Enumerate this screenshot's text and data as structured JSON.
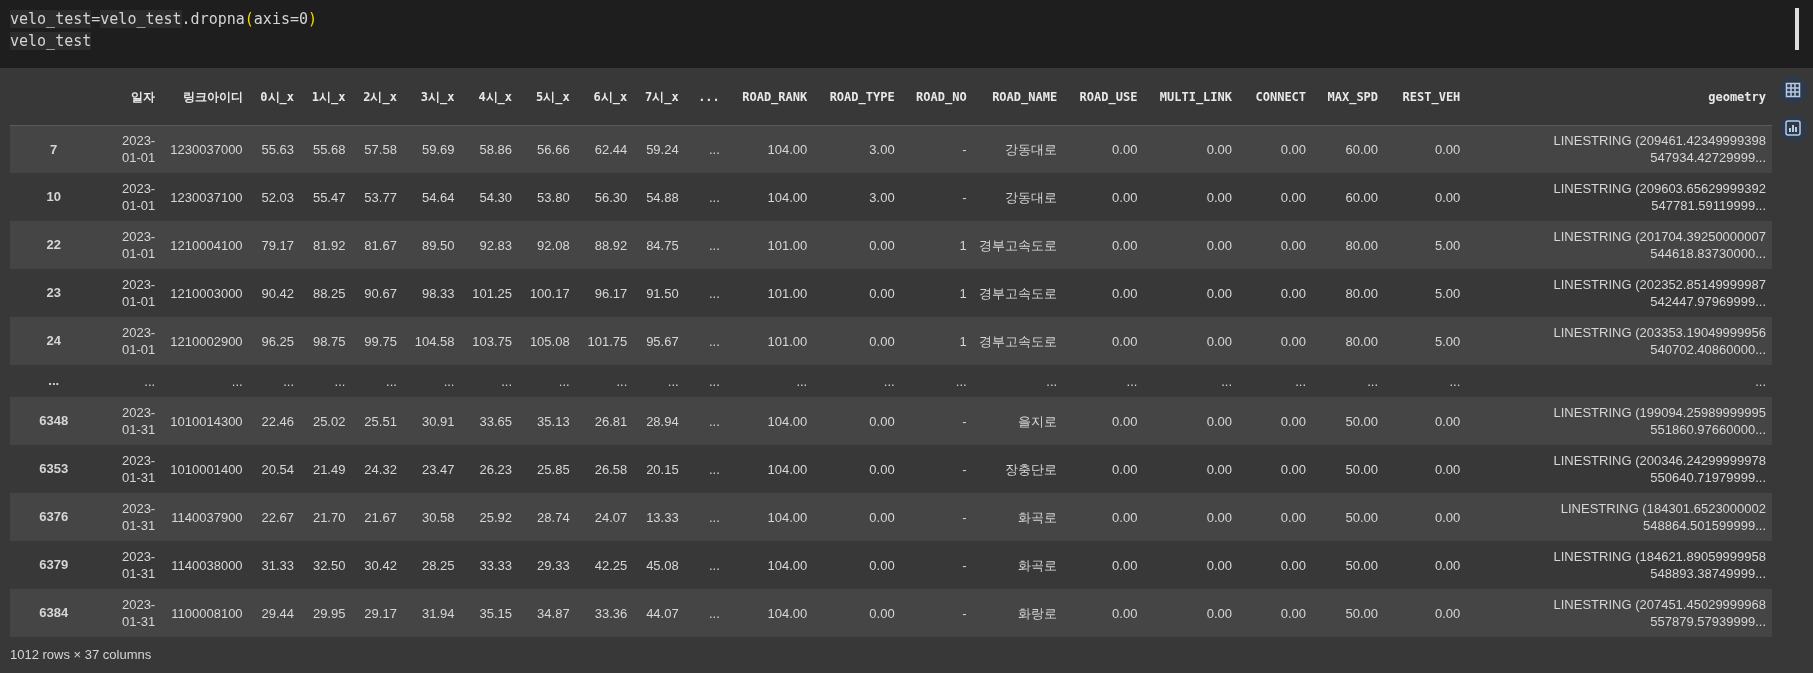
{
  "code_cell": {
    "lines": [
      [
        {
          "text": "velo_test",
          "kind": "match"
        },
        {
          "text": "=",
          "kind": "plain"
        },
        {
          "text": "velo_test",
          "kind": "match"
        },
        {
          "text": ".dropna",
          "kind": "plain"
        },
        {
          "text": "(",
          "kind": "paren"
        },
        {
          "text": "axis=0",
          "kind": "plain"
        },
        {
          "text": ")",
          "kind": "paren"
        }
      ],
      [
        {
          "text": "velo_test",
          "kind": "match"
        }
      ]
    ]
  },
  "table": {
    "columns": [
      "",
      "일자",
      "링크아이디",
      "0시_x",
      "1시_x",
      "2시_x",
      "3시_x",
      "4시_x",
      "5시_x",
      "6시_x",
      "7시_x",
      "...",
      "ROAD_RANK",
      "ROAD_TYPE",
      "ROAD_NO",
      "ROAD_NAME",
      "ROAD_USE",
      "MULTI_LINK",
      "CONNECT",
      "MAX_SPD",
      "REST_VEH",
      "geometry"
    ],
    "rows": [
      {
        "kind": "data",
        "cells": [
          "7",
          "2023-01-01",
          "1230037000",
          "55.63",
          "55.68",
          "57.58",
          "59.69",
          "58.86",
          "56.66",
          "62.44",
          "59.24",
          "...",
          "104.00",
          "3.00",
          "-",
          "강동대로",
          "0.00",
          "0.00",
          "0.00",
          "60.00",
          "0.00",
          "LINESTRING (209461.42349999398 547934.42729999..."
        ]
      },
      {
        "kind": "data",
        "cells": [
          "10",
          "2023-01-01",
          "1230037100",
          "52.03",
          "55.47",
          "53.77",
          "54.64",
          "54.30",
          "53.80",
          "56.30",
          "54.88",
          "...",
          "104.00",
          "3.00",
          "-",
          "강동대로",
          "0.00",
          "0.00",
          "0.00",
          "60.00",
          "0.00",
          "LINESTRING (209603.65629999392 547781.59119999..."
        ]
      },
      {
        "kind": "data",
        "cells": [
          "22",
          "2023-01-01",
          "1210004100",
          "79.17",
          "81.92",
          "81.67",
          "89.50",
          "92.83",
          "92.08",
          "88.92",
          "84.75",
          "...",
          "101.00",
          "0.00",
          "1",
          "경부고속도로",
          "0.00",
          "0.00",
          "0.00",
          "80.00",
          "5.00",
          "LINESTRING (201704.39250000007 544618.83730000..."
        ]
      },
      {
        "kind": "data",
        "cells": [
          "23",
          "2023-01-01",
          "1210003000",
          "90.42",
          "88.25",
          "90.67",
          "98.33",
          "101.25",
          "100.17",
          "96.17",
          "91.50",
          "...",
          "101.00",
          "0.00",
          "1",
          "경부고속도로",
          "0.00",
          "0.00",
          "0.00",
          "80.00",
          "5.00",
          "LINESTRING (202352.85149999987 542447.97969999..."
        ]
      },
      {
        "kind": "data",
        "cells": [
          "24",
          "2023-01-01",
          "1210002900",
          "96.25",
          "98.75",
          "99.75",
          "104.58",
          "103.75",
          "105.08",
          "101.75",
          "95.67",
          "...",
          "101.00",
          "0.00",
          "1",
          "경부고속도로",
          "0.00",
          "0.00",
          "0.00",
          "80.00",
          "5.00",
          "LINESTRING (203353.19049999956 540702.40860000..."
        ]
      },
      {
        "kind": "ellipsis",
        "cells": [
          "...",
          "...",
          "...",
          "...",
          "...",
          "...",
          "...",
          "...",
          "...",
          "...",
          "...",
          "...",
          "...",
          "...",
          "...",
          "...",
          "...",
          "...",
          "...",
          "...",
          "...",
          "..."
        ]
      },
      {
        "kind": "data",
        "cells": [
          "6348",
          "2023-01-31",
          "1010014300",
          "22.46",
          "25.02",
          "25.51",
          "30.91",
          "33.65",
          "35.13",
          "26.81",
          "28.94",
          "...",
          "104.00",
          "0.00",
          "-",
          "을지로",
          "0.00",
          "0.00",
          "0.00",
          "50.00",
          "0.00",
          "LINESTRING (199094.25989999995 551860.97660000..."
        ]
      },
      {
        "kind": "data",
        "cells": [
          "6353",
          "2023-01-31",
          "1010001400",
          "20.54",
          "21.49",
          "24.32",
          "23.47",
          "26.23",
          "25.85",
          "26.58",
          "20.15",
          "...",
          "104.00",
          "0.00",
          "-",
          "장충단로",
          "0.00",
          "0.00",
          "0.00",
          "50.00",
          "0.00",
          "LINESTRING (200346.24299999978 550640.71979999..."
        ]
      },
      {
        "kind": "data",
        "cells": [
          "6376",
          "2023-01-31",
          "1140037900",
          "22.67",
          "21.70",
          "21.67",
          "30.58",
          "25.92",
          "28.74",
          "24.07",
          "13.33",
          "...",
          "104.00",
          "0.00",
          "-",
          "화곡로",
          "0.00",
          "0.00",
          "0.00",
          "50.00",
          "0.00",
          "LINESTRING (184301.6523000002 548864.501599999..."
        ]
      },
      {
        "kind": "data",
        "cells": [
          "6379",
          "2023-01-31",
          "1140038000",
          "31.33",
          "32.50",
          "30.42",
          "28.25",
          "33.33",
          "29.33",
          "42.25",
          "45.08",
          "...",
          "104.00",
          "0.00",
          "-",
          "화곡로",
          "0.00",
          "0.00",
          "0.00",
          "50.00",
          "0.00",
          "LINESTRING (184621.89059999958 548893.38749999..."
        ]
      },
      {
        "kind": "data",
        "cells": [
          "6384",
          "2023-01-31",
          "1100008100",
          "29.44",
          "29.95",
          "29.17",
          "31.94",
          "35.15",
          "34.87",
          "33.36",
          "44.07",
          "...",
          "104.00",
          "0.00",
          "-",
          "화랑로",
          "0.00",
          "0.00",
          "0.00",
          "50.00",
          "0.00",
          "LINESTRING (207451.45029999968 557879.57939999..."
        ]
      }
    ]
  },
  "footer": "1012 rows × 37 columns"
}
